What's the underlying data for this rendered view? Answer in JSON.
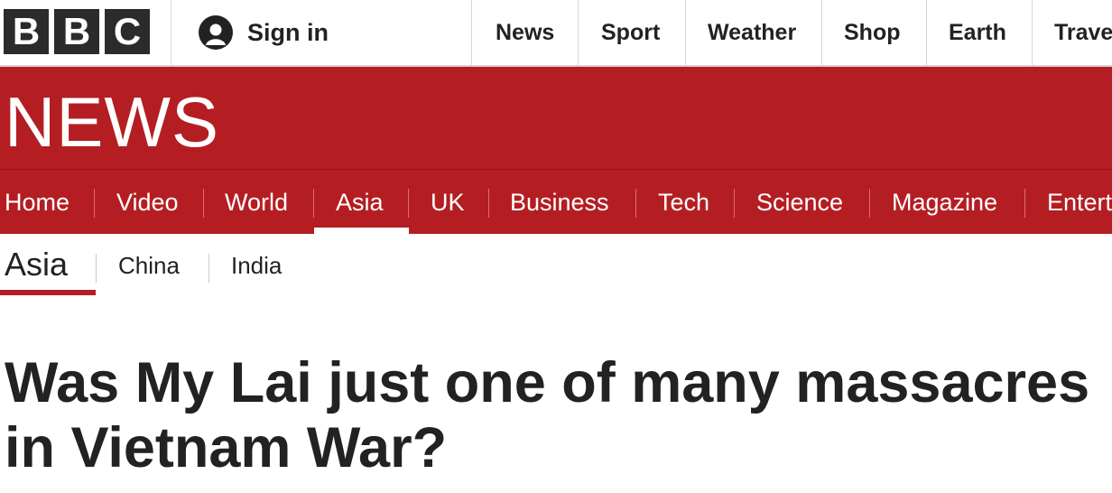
{
  "header": {
    "logo_letters": [
      "B",
      "B",
      "C"
    ],
    "sign_in_label": "Sign in",
    "nav": [
      "News",
      "Sport",
      "Weather",
      "Shop",
      "Earth",
      "Trave"
    ]
  },
  "masthead": {
    "title": "NEWS"
  },
  "section_nav": {
    "items": [
      "Home",
      "Video",
      "World",
      "Asia",
      "UK",
      "Business",
      "Tech",
      "Science",
      "Magazine",
      "Entert"
    ],
    "active": "Asia"
  },
  "sub_nav": {
    "current": "Asia",
    "items": [
      "China",
      "India"
    ]
  },
  "article": {
    "headline": "Was My Lai just one of many massacres in Vietnam War?"
  },
  "colors": {
    "brand_red": "#b41e22",
    "logo_block": "#2b2b2b",
    "text": "#222222"
  },
  "icons": {
    "sign_in": "user-icon"
  }
}
